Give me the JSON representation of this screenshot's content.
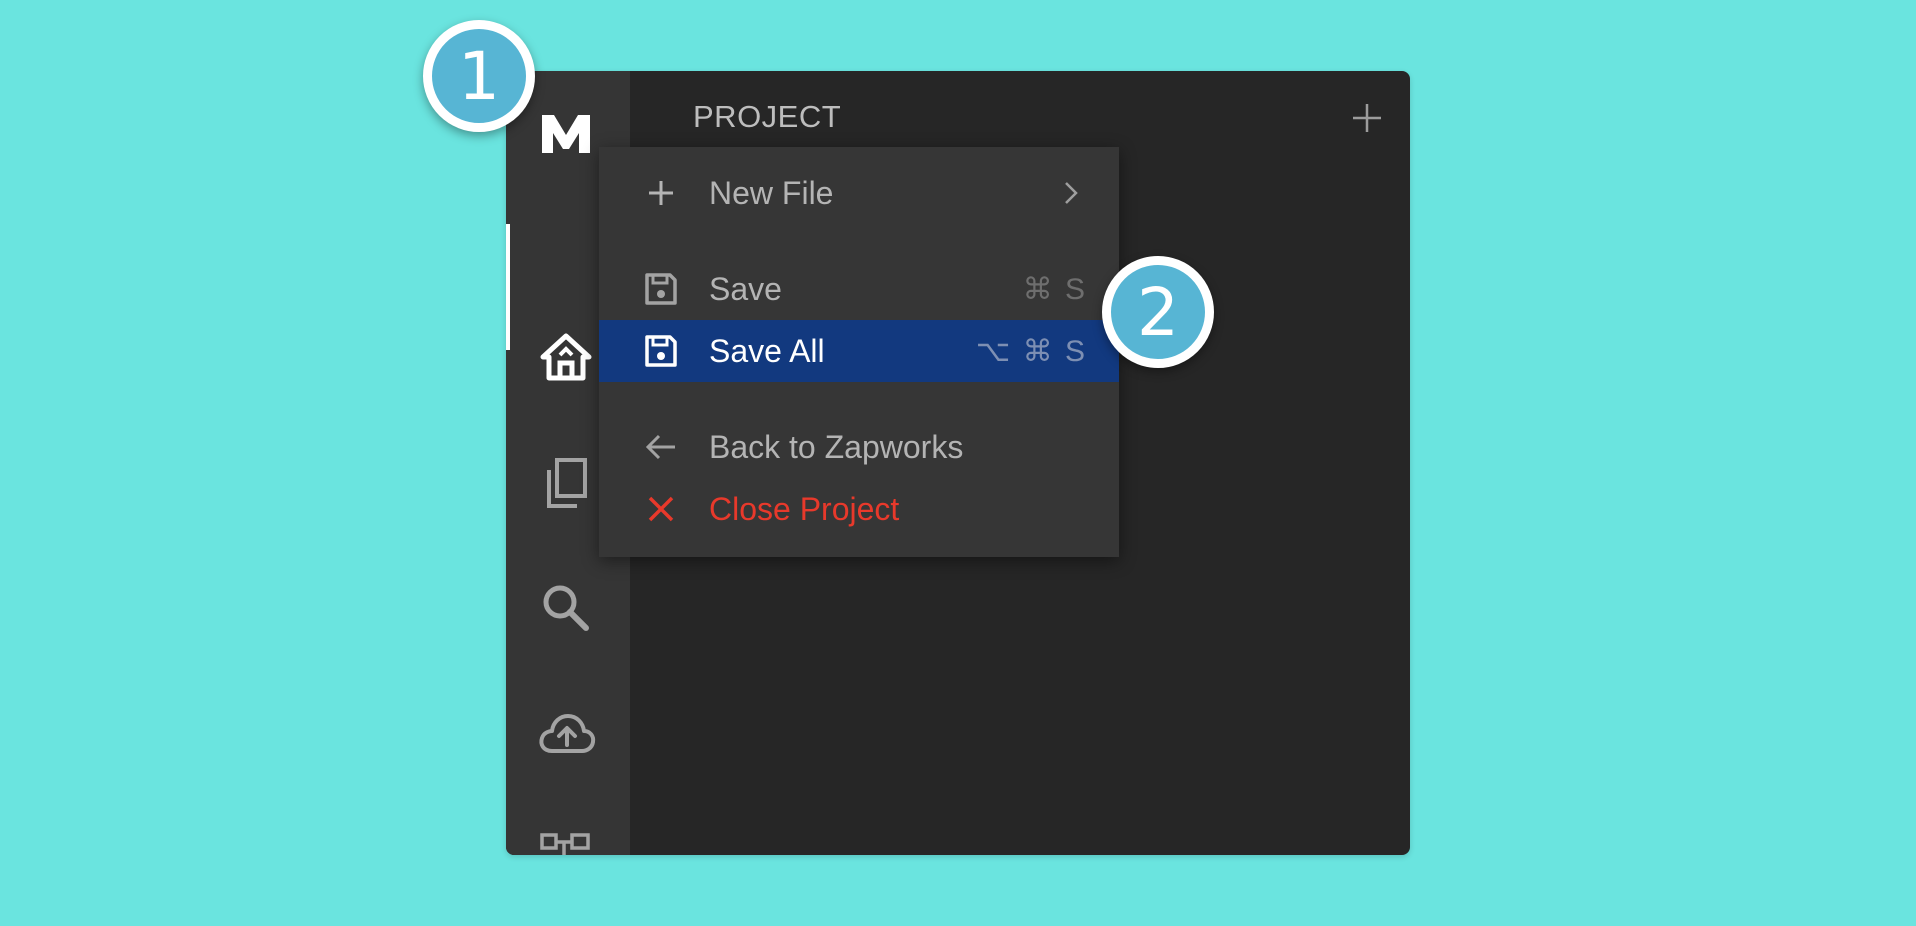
{
  "sidebar": {
    "logo_icon": "m-logo-icon",
    "items": [
      {
        "name": "home",
        "icon": "home-icon",
        "active": true
      },
      {
        "name": "files",
        "icon": "copy-files-icon",
        "active": false
      },
      {
        "name": "search",
        "icon": "search-icon",
        "active": false
      },
      {
        "name": "publish",
        "icon": "cloud-upload-icon",
        "active": false
      },
      {
        "name": "hierarchy",
        "icon": "hierarchy-icon",
        "active": false
      }
    ]
  },
  "panel": {
    "title": "PROJECT",
    "add_icon": "plus-icon"
  },
  "menu": {
    "items": [
      {
        "label": "New File",
        "icon": "plus-icon",
        "submenu": true
      },
      {
        "label": "Save",
        "icon": "save-icon",
        "shortcut": "⌘ S"
      },
      {
        "label": "Save All",
        "icon": "save-icon",
        "shortcut": "⌥ ⌘ S",
        "highlighted": true
      },
      {
        "label": "Back to Zapworks",
        "icon": "arrow-left-icon"
      },
      {
        "label": "Close Project",
        "icon": "close-icon",
        "color": "#e8392b"
      }
    ]
  },
  "callouts": [
    {
      "number": "1"
    },
    {
      "number": "2"
    }
  ],
  "colors": {
    "background": "#6ae4df",
    "window": "#262626",
    "sidebar": "#353535",
    "menu": "#363636",
    "highlight": "#12397f",
    "danger": "#e8392b",
    "callout": "#57b5d4"
  }
}
